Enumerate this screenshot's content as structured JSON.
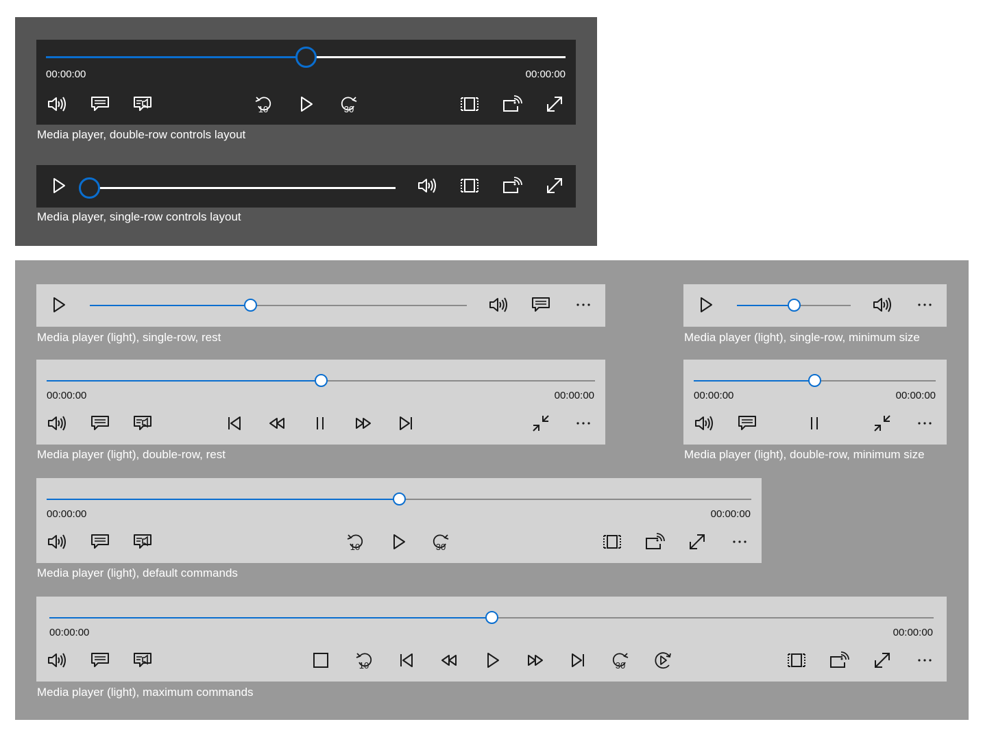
{
  "colors": {
    "accent": "#0a6ecf",
    "dark_panel": "#555555",
    "dark_player": "#262626",
    "light_panel": "#999999",
    "light_player": "#d3d3d3"
  },
  "skip_back_seconds": "10",
  "skip_forward_seconds": "30",
  "players": {
    "dark_double": {
      "caption": "Media player, double-row controls layout",
      "time_elapsed": "00:00:00",
      "time_remaining": "00:00:00",
      "progress": 0.5,
      "controls": [
        "volume-icon",
        "closed-captions-icon",
        "audio-language-icon",
        "skip-back-icon",
        "play-icon",
        "skip-forward-icon",
        "zoom-icon",
        "cast-icon",
        "full-screen-icon"
      ]
    },
    "dark_single": {
      "caption": "Media player, single-row controls layout",
      "progress": 0.0,
      "controls": [
        "play-icon",
        "volume-icon",
        "zoom-icon",
        "cast-icon",
        "full-screen-icon"
      ]
    },
    "light_single_rest": {
      "caption": "Media player (light), single-row, rest",
      "progress": 0.427,
      "controls": [
        "play-icon",
        "volume-icon",
        "closed-captions-icon",
        "more-icon"
      ]
    },
    "light_single_min": {
      "caption": "Media player (light), single-row, minimum size",
      "progress": 0.5,
      "controls": [
        "play-icon",
        "volume-icon",
        "more-icon"
      ]
    },
    "light_double_rest": {
      "caption": "Media player (light), double-row, rest",
      "time_elapsed": "00:00:00",
      "time_remaining": "00:00:00",
      "progress": 0.5,
      "controls": [
        "volume-icon",
        "closed-captions-icon",
        "audio-language-icon",
        "previous-track-icon",
        "rewind-icon",
        "pause-icon",
        "fast-forward-icon",
        "next-track-icon",
        "exit-full-screen-icon",
        "more-icon"
      ]
    },
    "light_double_min": {
      "caption": "Media player (light), double-row, minimum size",
      "time_elapsed": "00:00:00",
      "time_remaining": "00:00:00",
      "progress": 0.5,
      "controls": [
        "volume-icon",
        "closed-captions-icon",
        "pause-icon",
        "exit-full-screen-icon",
        "more-icon"
      ]
    },
    "light_default": {
      "caption": "Media player (light), default commands",
      "time_elapsed": "00:00:00",
      "time_remaining": "00:00:00",
      "progress": 0.5,
      "controls": [
        "volume-icon",
        "closed-captions-icon",
        "audio-language-icon",
        "skip-back-icon",
        "play-icon",
        "skip-forward-icon",
        "zoom-icon",
        "cast-icon",
        "full-screen-icon",
        "more-icon"
      ]
    },
    "light_maximum": {
      "caption": "Media player (light), maximum commands",
      "time_elapsed": "00:00:00",
      "time_remaining": "00:00:00",
      "progress": 0.5,
      "controls": [
        "volume-icon",
        "closed-captions-icon",
        "audio-language-icon",
        "stop-icon",
        "skip-back-icon",
        "previous-track-icon",
        "rewind-icon",
        "play-icon",
        "fast-forward-icon",
        "next-track-icon",
        "skip-forward-icon",
        "playback-rate-icon",
        "zoom-icon",
        "cast-icon",
        "full-screen-icon",
        "more-icon"
      ]
    }
  }
}
